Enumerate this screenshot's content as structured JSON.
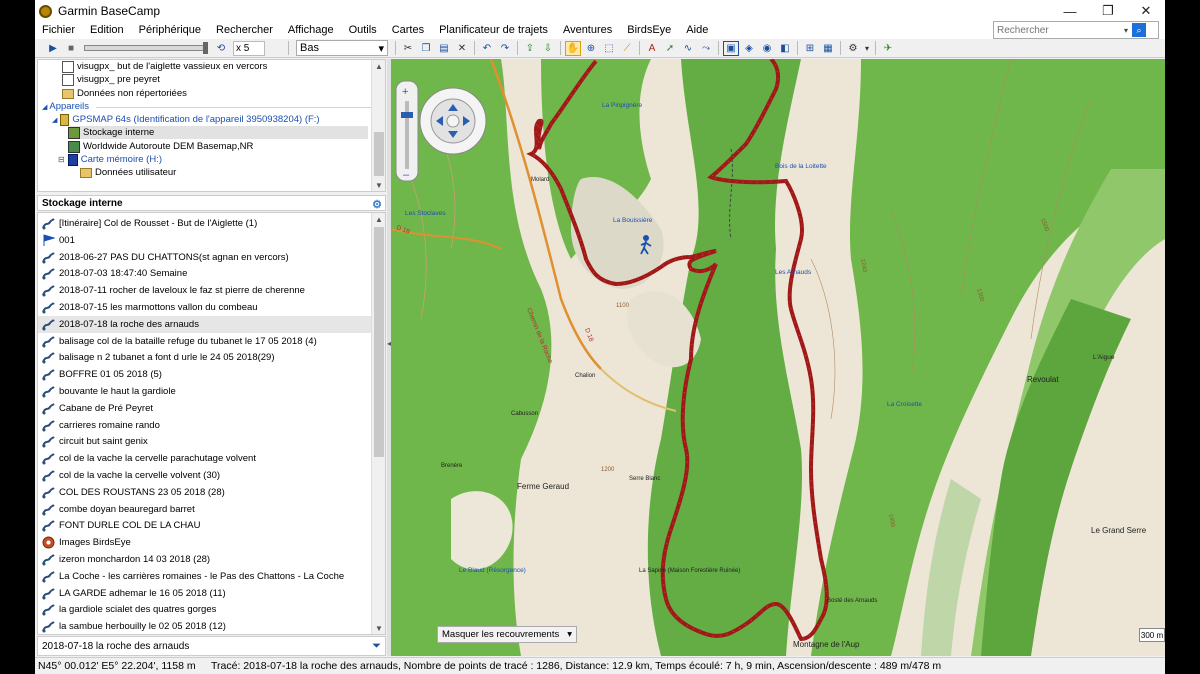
{
  "window": {
    "title": "Garmin BaseCamp",
    "controls": [
      "—",
      "❐",
      "✕"
    ]
  },
  "menu": [
    "Fichier",
    "Edition",
    "Périphérique",
    "Rechercher",
    "Affichage",
    "Outils",
    "Cartes",
    "Planificateur de trajets",
    "Aventures",
    "BirdsEye",
    "Aide"
  ],
  "search": {
    "placeholder": "Rechercher"
  },
  "toolbar": {
    "speed": "x 5",
    "quality": "Bas"
  },
  "tree": {
    "items": [
      {
        "label": "visugpx_ but de l'aiglette  vassieux en vercors",
        "icon": "document-icon"
      },
      {
        "label": "visugpx_ pre peyret",
        "icon": "document-icon"
      },
      {
        "label": "Données non répertoriées",
        "icon": "folder-icon"
      },
      {
        "label": "Appareils",
        "icon": "section"
      },
      {
        "label": "GPSMAP 64s (Identification de l'appareil 3950938204) (F:)",
        "icon": "device-icon"
      },
      {
        "label": "Stockage interne",
        "icon": "storage-icon"
      },
      {
        "label": "Worldwide Autoroute DEM Basemap,NR",
        "icon": "map-icon"
      },
      {
        "label": "Carte mémoire (H:)",
        "icon": "card-icon"
      },
      {
        "label": "Données utilisateur",
        "icon": "folder-icon"
      }
    ]
  },
  "list": {
    "header": "Stockage interne",
    "items": [
      {
        "label": "[Itinéraire] Col de Rousset - But de l'Aiglette (1)",
        "icon": "route-icon"
      },
      {
        "label": "001",
        "icon": "flag-icon"
      },
      {
        "label": "2018-06-27 PAS DU CHATTONS(st agnan en vercors)",
        "icon": "track-icon"
      },
      {
        "label": "2018-07-03 18:47:40 Semaine",
        "icon": "track-icon"
      },
      {
        "label": "2018-07-11 rocher de laveloux le faz  st pierre de cherenne",
        "icon": "track-icon"
      },
      {
        "label": "2018-07-15  les marmottons  vallon du combeau",
        "icon": "track-icon"
      },
      {
        "label": "2018-07-18  la roche des arnauds",
        "icon": "track-icon",
        "selected": true
      },
      {
        "label": "balisage  col de la bataille refuge du tubanet le 17 05 2018 (4)",
        "icon": "track-icon"
      },
      {
        "label": "balisage n 2 tubanet a font d urle  le 24 05 2018(29)",
        "icon": "track-icon"
      },
      {
        "label": "BOFFRE 01 05 2018  (5)",
        "icon": "track-icon"
      },
      {
        "label": "bouvante le haut  la gardiole",
        "icon": "track-icon"
      },
      {
        "label": "Cabane de Pré Peyret",
        "icon": "track-icon"
      },
      {
        "label": "carrieres romaine rando",
        "icon": "track-icon"
      },
      {
        "label": "circuit  but saint genix",
        "icon": "track-icon"
      },
      {
        "label": "col de la vache  la cervelle  parachutage volvent",
        "icon": "track-icon"
      },
      {
        "label": "col de la vache la cervelle volvent (30)",
        "icon": "track-icon"
      },
      {
        "label": "COL DES ROUSTANS  23 05 2018  (28)",
        "icon": "track-icon"
      },
      {
        "label": "combe doyan beauregard barret",
        "icon": "track-icon"
      },
      {
        "label": "FONT DURLE COL DE LA CHAU",
        "icon": "track-icon"
      },
      {
        "label": "Images BirdsEye",
        "icon": "birdseye-icon"
      },
      {
        "label": "izeron  monchardon 14  03 2018  (28)",
        "icon": "track-icon"
      },
      {
        "label": "La Coche - les carrières romaines - le Pas des Chattons - La Coche",
        "icon": "track-icon"
      },
      {
        "label": "LA GARDE  adhemar le 16 05 2018 (11)",
        "icon": "track-icon"
      },
      {
        "label": "la gardiole  scialet des quatres gorges",
        "icon": "track-icon"
      },
      {
        "label": "la sambue  herbouilly le 02 05 2018 (12)",
        "icon": "track-icon"
      }
    ]
  },
  "filter": {
    "value": "2018-07-18  la roche des arnauds"
  },
  "map": {
    "overlay_dropdown": "Masquer les recouvrements",
    "scale": "300 m",
    "labels": {
      "pinpignere": "La Pinpignère",
      "boisdelaloitette": "Bois de la Loitette",
      "lesstoclaves": "Les Stoclaves",
      "labouissiere": "La Bouissière",
      "lesarnauds": "Les Arnauds",
      "molard": "Molard",
      "laigue": "L'Aigue",
      "revoulat": "Revoulat",
      "lacroisette": "La Croisette",
      "chalion": "Chalion",
      "cabusson": "Cabusson",
      "brenere": "Brenère",
      "fermegeraud": "Ferme Geraud",
      "serreblanc": "Serre Blanc",
      "legrandserre": "Le Grand Serre",
      "lablaud": "Le Blaud (Résorgence)",
      "lasapine": "La Sapine (Maison Forestière Ruinée)",
      "bostedesarnauds": "Bosté des Arnauds",
      "montagnedelaup": "Montagne de l'Aup",
      "roads": [
        "D 18",
        "Chemin de la Roche",
        "D 18"
      ],
      "elev": [
        "1100",
        "1240",
        "1300",
        "1400",
        "1500",
        "1200"
      ]
    }
  },
  "status": {
    "coords": "N45° 00.012' E5° 22.204', 1158 m",
    "info": "Tracé: 2018-07-18  la roche des arnauds, Nombre de points de tracé : 1286, Distance: 12.9 km, Temps écoulé: 7 h, 9 min, Ascension/descente : 489 m/478 m"
  }
}
